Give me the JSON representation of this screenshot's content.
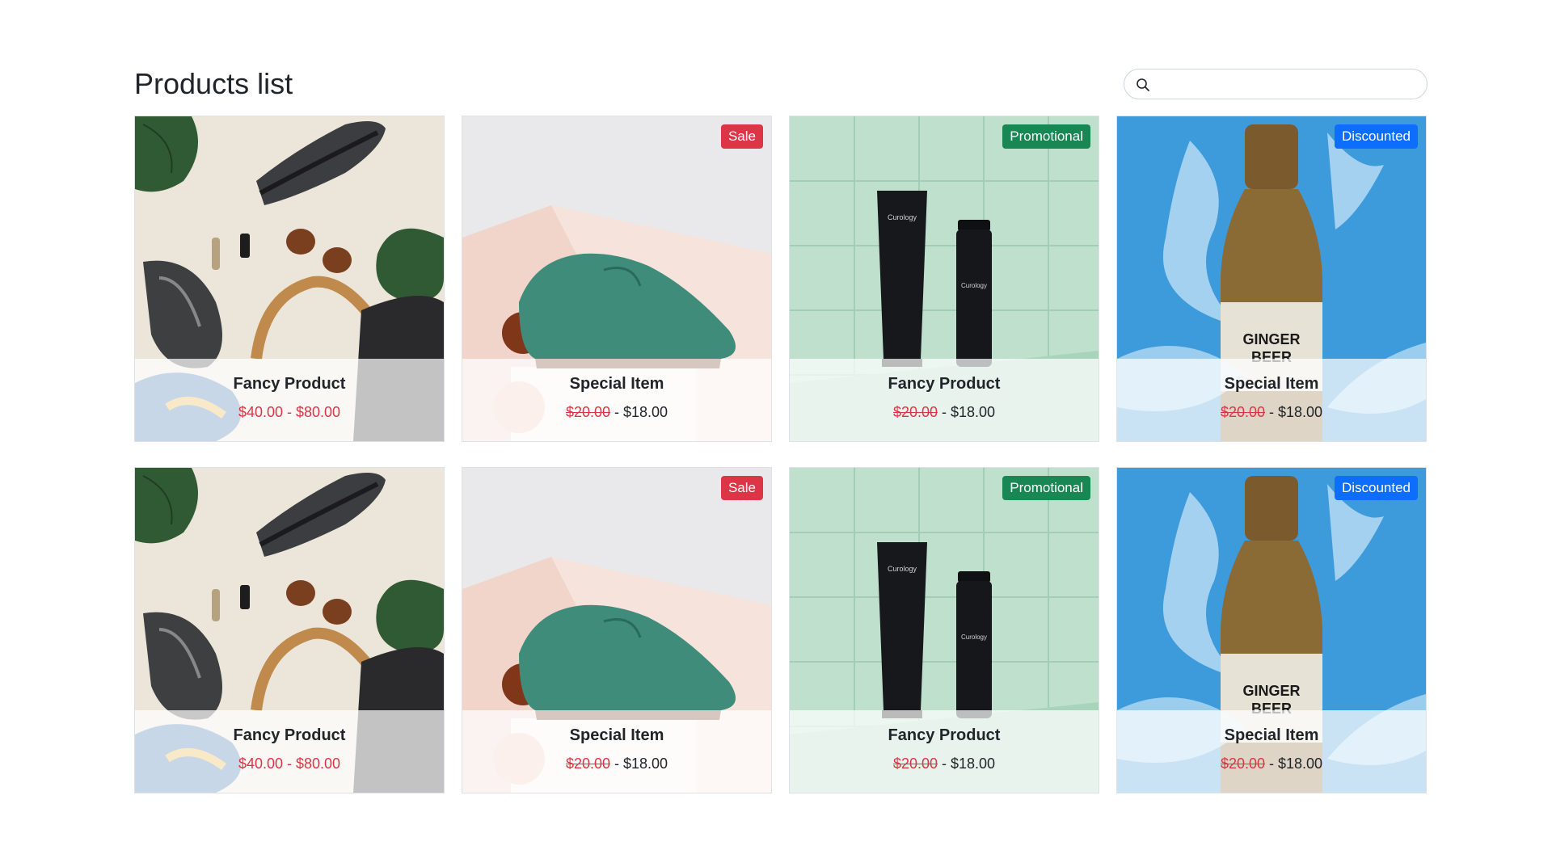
{
  "page": {
    "title": "Products list"
  },
  "search": {
    "value": "",
    "placeholder": "",
    "icon": "search-icon"
  },
  "colors": {
    "sale_badge": "#dc3545",
    "promotional_badge": "#198754",
    "discounted_badge": "#0d6efd",
    "old_price": "#dc3545"
  },
  "products": [
    {
      "name": "Fancy Product",
      "image": "flatlay-sneakers-sunglasses-bag",
      "badge": "",
      "price_range": "$40.00 - $80.00",
      "old_price": "",
      "sep": "",
      "new_price": ""
    },
    {
      "name": "Special Item",
      "image": "green-suede-shoe",
      "badge": "Sale",
      "price_range": "",
      "old_price": "$20.00",
      "sep": " - ",
      "new_price": "$18.00"
    },
    {
      "name": "Fancy Product",
      "image": "skincare-tube-and-bottle",
      "badge": "Promotional",
      "price_range": "",
      "old_price": "$20.00",
      "sep": " - ",
      "new_price": "$18.00"
    },
    {
      "name": "Special Item",
      "image": "ginger-beer-bottle-splash",
      "badge": "Discounted",
      "price_range": "",
      "old_price": "$20.00",
      "sep": " - ",
      "new_price": "$18.00"
    },
    {
      "name": "Fancy Product",
      "image": "flatlay-sneakers-sunglasses-bag",
      "badge": "",
      "price_range": "$40.00 - $80.00",
      "old_price": "",
      "sep": "",
      "new_price": ""
    },
    {
      "name": "Special Item",
      "image": "green-suede-shoe",
      "badge": "Sale",
      "price_range": "",
      "old_price": "$20.00",
      "sep": " - ",
      "new_price": "$18.00"
    },
    {
      "name": "Fancy Product",
      "image": "skincare-tube-and-bottle",
      "badge": "Promotional",
      "price_range": "",
      "old_price": "$20.00",
      "sep": " - ",
      "new_price": "$18.00"
    },
    {
      "name": "Special Item",
      "image": "ginger-beer-bottle-splash",
      "badge": "Discounted",
      "price_range": "",
      "old_price": "$20.00",
      "sep": " - ",
      "new_price": "$18.00"
    }
  ]
}
